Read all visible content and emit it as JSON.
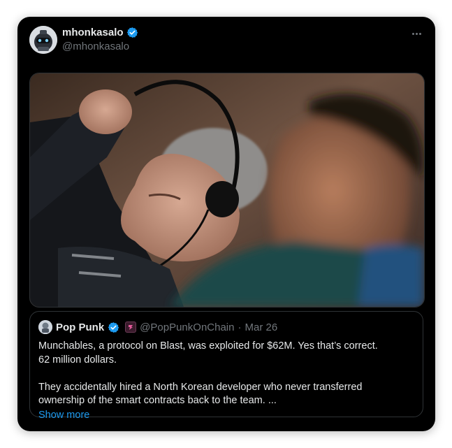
{
  "tweet": {
    "author": {
      "name": "mhonkasalo",
      "handle": "@mhonkasalo",
      "verified": true,
      "avatar_icon": "robot-helmet-avatar"
    },
    "more_icon": "more-horizontal-icon",
    "media": {
      "type": "photo"
    },
    "quote": {
      "author_name": "Pop Punk",
      "handle": "@PopPunkOnChain",
      "separator": "·",
      "date": "Mar 26",
      "verified": true,
      "affiliate_badge": "affiliate-badge-icon",
      "text_line1": "Munchables, a protocol on Blast, was exploited for $62M. Yes that’s correct.",
      "text_line2": "62 million dollars.",
      "text_line3": "They accidentally hired a North Korean developer who never transferred",
      "text_line4": "ownership of the smart contracts back to the team. ...",
      "show_more": "Show more"
    }
  },
  "colors": {
    "background": "#000000",
    "text_primary": "#e7e9ea",
    "text_secondary": "#71767b",
    "verified_blue": "#1d9bf0",
    "link_blue": "#1d9bf0",
    "border": "#2f3336"
  }
}
